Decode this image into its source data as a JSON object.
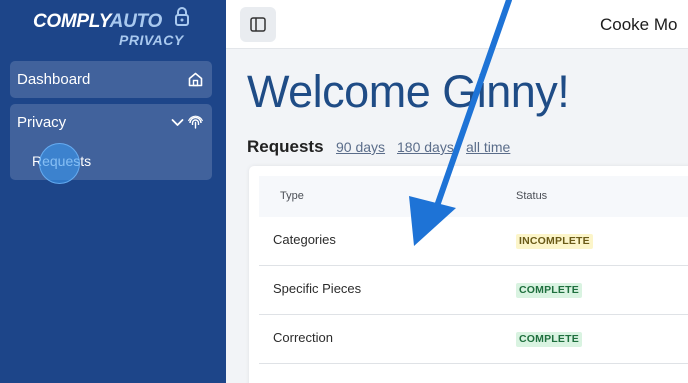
{
  "sidebar": {
    "brand": {
      "comply": "COMPLY",
      "auto": "AUTO",
      "sub": "PRIVACY"
    },
    "items": [
      {
        "label": "Dashboard",
        "icon": "home-icon"
      },
      {
        "label": "Privacy",
        "icon": "fingerprint-icon",
        "children": [
          {
            "label": "Requests"
          }
        ]
      }
    ]
  },
  "header": {
    "company": "Cooke Mo"
  },
  "main": {
    "welcome": "Welcome Ginny!",
    "requests_title": "Requests",
    "ranges": [
      "90 days",
      "180 days",
      "all time"
    ],
    "table": {
      "columns": [
        "Type",
        "Status"
      ],
      "rows": [
        {
          "type": "Categories",
          "status": "INCOMPLETE"
        },
        {
          "type": "Specific Pieces",
          "status": "COMPLETE"
        },
        {
          "type": "Correction",
          "status": "COMPLETE"
        }
      ]
    }
  },
  "colors": {
    "sidebar": "#1d4589",
    "accent": "#1f4c86",
    "annotation_arrow": "#1e73d6",
    "incomplete_badge": "#fcf5c9",
    "complete_badge": "#d9f3e1"
  }
}
